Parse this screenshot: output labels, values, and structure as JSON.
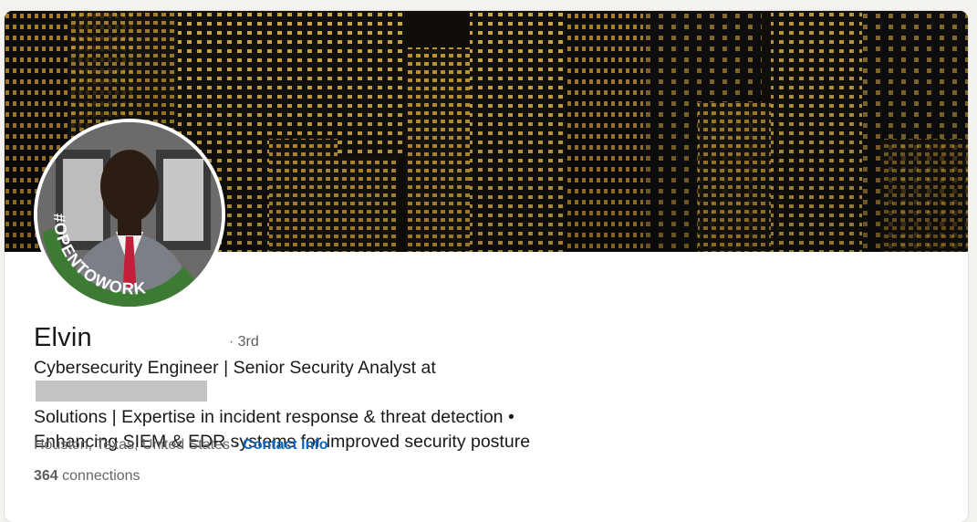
{
  "profile": {
    "first_name": "Elvin",
    "degree": "· 3rd",
    "headline_line1": "Cybersecurity Engineer | Senior Security Analyst at",
    "headline_line2": "Solutions | Expertise in incident response & threat detection •",
    "headline_line3": "Enhancing SIEM & EDR systems for improved security posture",
    "location": "Houston, Texas, United States",
    "separator": "·",
    "contact_info": "Contact info",
    "connections_count": "364",
    "connections_label": "connections",
    "open_to_work_badge": "#OPENTOWORK"
  },
  "icons": {
    "cover": "city-skyline-night-image",
    "avatar": "profile-photo"
  },
  "colors": {
    "link": "#0a66c2",
    "open_to_work_ring": "#3d7a34",
    "text_primary": "#191919",
    "text_secondary": "#666666"
  }
}
